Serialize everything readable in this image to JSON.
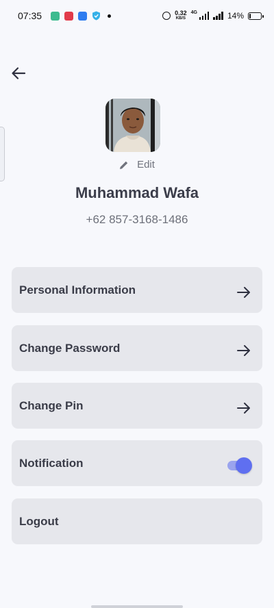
{
  "status_bar": {
    "time": "07:35",
    "speed_value": "0.32",
    "speed_unit": "KB/S",
    "network_tag": "4G",
    "battery_percent": "14%",
    "battery_level": 0.14,
    "app_icon_colors": [
      "#3dbb8f",
      "#e23b4a",
      "#2f7df0",
      "#35b0e8"
    ]
  },
  "header": {
    "back_icon": "arrow-left-icon"
  },
  "profile": {
    "edit_label": "Edit",
    "name": "Muhammad Wafa",
    "phone": "+62 857-3168-1486"
  },
  "menu": {
    "personal_information": "Personal Information",
    "change_password": "Change Password",
    "change_pin": "Change Pin",
    "notification": "Notification",
    "notification_enabled": true,
    "logout": "Logout"
  },
  "colors": {
    "accent": "#5f6ff0",
    "card_bg": "#e6e7ec",
    "page_bg": "#f7f8fc"
  }
}
